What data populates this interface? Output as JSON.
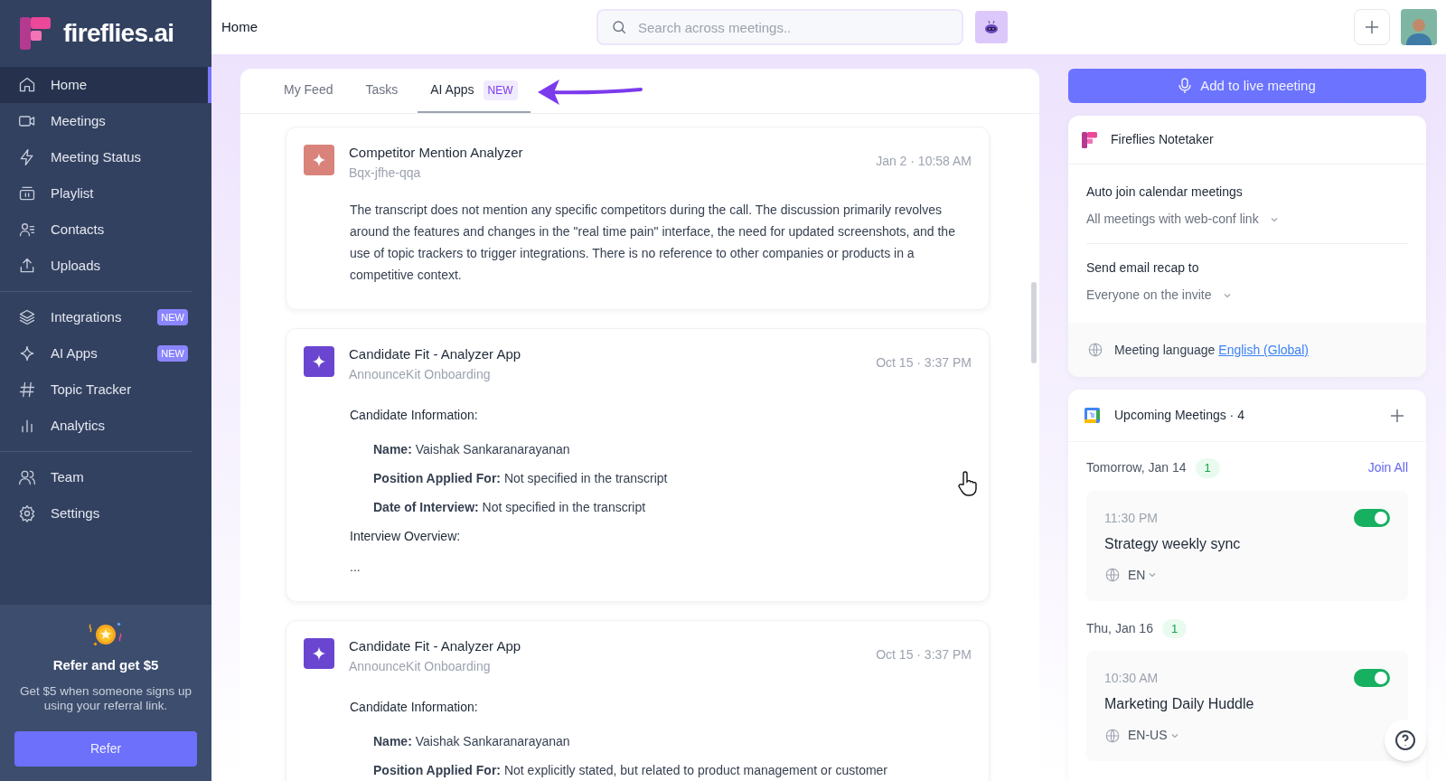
{
  "sidebar": {
    "logo": "fireflies.ai",
    "groups": [
      [
        {
          "label": "Home",
          "selected": true
        },
        {
          "label": "Meetings",
          "selected": false
        },
        {
          "label": "Meeting Status",
          "selected": false
        },
        {
          "label": "Playlist",
          "selected": false
        },
        {
          "label": "Contacts",
          "selected": false
        },
        {
          "label": "Uploads",
          "selected": false
        }
      ],
      [
        {
          "label": "Integrations",
          "selected": false,
          "badge": "NEW"
        },
        {
          "label": "AI Apps",
          "selected": false,
          "badge": "NEW"
        },
        {
          "label": "Topic Tracker",
          "selected": false
        },
        {
          "label": "Analytics",
          "selected": false
        }
      ],
      [
        {
          "label": "Team",
          "selected": false
        },
        {
          "label": "Settings",
          "selected": false
        }
      ]
    ],
    "referral": {
      "title": "Refer and get $5",
      "text": "Get $5 when someone signs up using your referral link.",
      "button": "Refer"
    }
  },
  "header": {
    "title": "Home",
    "search": {
      "placeholder": "Search across meetings.."
    }
  },
  "feed": {
    "tabs": [
      {
        "label": "My Feed",
        "selected": false
      },
      {
        "label": "Tasks",
        "selected": false
      },
      {
        "label": "AI Apps",
        "selected": true,
        "badge": "NEW"
      }
    ],
    "cards": [
      {
        "color": "#d9837b",
        "title": "Competitor Mention Analyzer",
        "subtitle": "Bqx-jfhe-qqa",
        "time": "Jan 2 · 10:58 AM",
        "body": [
          {
            "kind": "paragraph",
            "text": "The transcript does not mention any specific competitors during the call. The discussion primarily revolves around the features and changes in the \"real time pain\" interface, the need for updated screenshots, and the use of topic trackers to trigger integrations. There is no reference to other companies or products in a competitive context."
          }
        ]
      },
      {
        "color": "#6a45d0",
        "title": "Candidate Fit - Analyzer App",
        "subtitle": "AnnounceKit Onboarding",
        "time": "Oct 15 · 3:37 PM",
        "body": [
          {
            "kind": "heading",
            "text": "Candidate Information:"
          },
          {
            "kind": "field",
            "text": "**Name:** Vaishak Sankaranarayanan"
          },
          {
            "kind": "field",
            "text": "**Position Applied For:** Not specified in the transcript"
          },
          {
            "kind": "field",
            "text": "**Date of Interview:** Not specified in the transcript"
          },
          {
            "kind": "heading",
            "text": "Interview Overview:"
          },
          {
            "kind": "paragraph",
            "text": "..."
          }
        ]
      },
      {
        "color": "#6a45d0",
        "title": "Candidate Fit - Analyzer App",
        "subtitle": "AnnounceKit Onboarding",
        "time": "Oct 15 · 3:37 PM",
        "body": [
          {
            "kind": "heading",
            "text": "Candidate Information:"
          },
          {
            "kind": "field",
            "text": "**Name:** Vaishak Sankaranarayanan"
          },
          {
            "kind": "field",
            "text": "**Position Applied For:** Not explicitly stated, but related to product management or customer"
          }
        ]
      }
    ]
  },
  "live_button": "Add to live meeting",
  "notetaker": {
    "title": "Fireflies Notetaker",
    "settings": [
      {
        "label": "Auto join calendar meetings",
        "value": "All meetings with web-conf link"
      },
      {
        "label": "Send email recap to",
        "value": "Everyone on the invite"
      }
    ],
    "language_label": "Meeting language",
    "language": "English (Global)"
  },
  "upcoming": {
    "title": "Upcoming Meetings · 4",
    "days": [
      {
        "date": "Tomorrow, Jan 14",
        "count": "1",
        "action": "Join All",
        "meetings": [
          {
            "time": "11:30 PM",
            "title": "Strategy weekly sync",
            "language": "EN",
            "on": true
          }
        ]
      },
      {
        "date": "Thu, Jan 16",
        "count": "1",
        "meetings": [
          {
            "time": "10:30 AM",
            "title": "Marketing Daily Huddle",
            "language": "EN-US",
            "on": true
          }
        ]
      }
    ]
  }
}
